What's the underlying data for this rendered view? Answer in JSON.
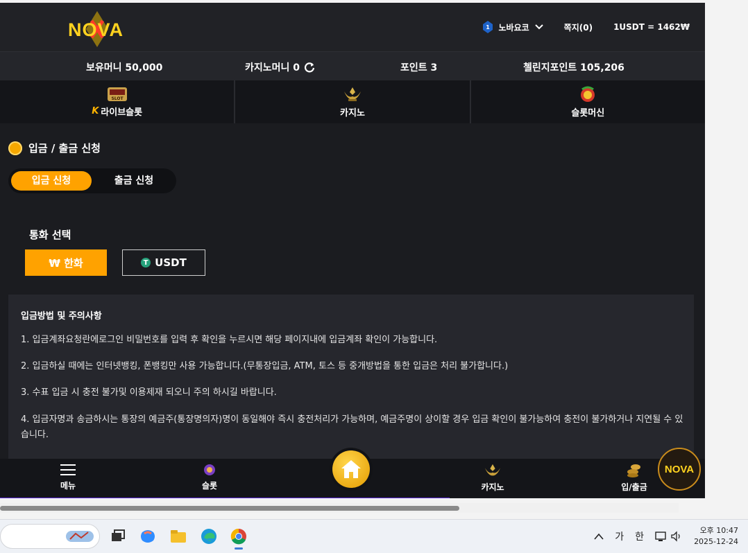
{
  "header": {
    "logo_text": "NOVA",
    "user_name": "노바요코",
    "messages": "쪽지(0)",
    "rate": "1USDT = 1462₩"
  },
  "stats": {
    "money": "보유머니 50,000",
    "casino_money": "카지노머니 0",
    "points": "포인트 3",
    "challenge": "첼린지포인트 105,206"
  },
  "categories": {
    "live_slot": "라이브슬롯",
    "casino": "카지노",
    "slot_machine": "슬롯머신",
    "slot_badge": "SLOT"
  },
  "section_title": "입금 / 출금 신청",
  "tabs": {
    "deposit": "입금 신청",
    "withdraw": "출금 신청"
  },
  "currency": {
    "label": "통화 선택",
    "krw": "₩ 한화",
    "usdt": "USDT"
  },
  "notice": {
    "title": "입금방법 및 주의사항",
    "items": [
      "1. 입금계좌요청란에로그인 비밀번호를 입력 후 확인을 누르시면 해당 페이지내에 입금계좌 확인이 가능합니다.",
      "2. 입금하실 때에는 인터넷뱅킹, 폰뱅킹만 사용 가능합니다.(무통장입금, ATM, 토스 등 중개방법을 통한 입금은 처리 불가합니다.)",
      "3. 수표 입금 시 충전 불가및 이용제재 되오니 주의 하시길 바랍니다.",
      "4. 입금자명과 송금하시는 통장의 예금주(통장명의자)명이 동일해야 즉시 충전처리가 가능하며, 예금주명이 상이할 경우 입금 확인이 불가능하여 충전이 불가하거나 지연될 수 있습니다."
    ]
  },
  "bottom_nav": {
    "menu": "메뉴",
    "slot": "슬롯",
    "casino": "카지노",
    "deposit": "입/출금"
  },
  "taskbar": {
    "ime_ga": "가",
    "ime_han": "한",
    "clock_time": "오후 10:47",
    "clock_date": "2025-12-24"
  }
}
